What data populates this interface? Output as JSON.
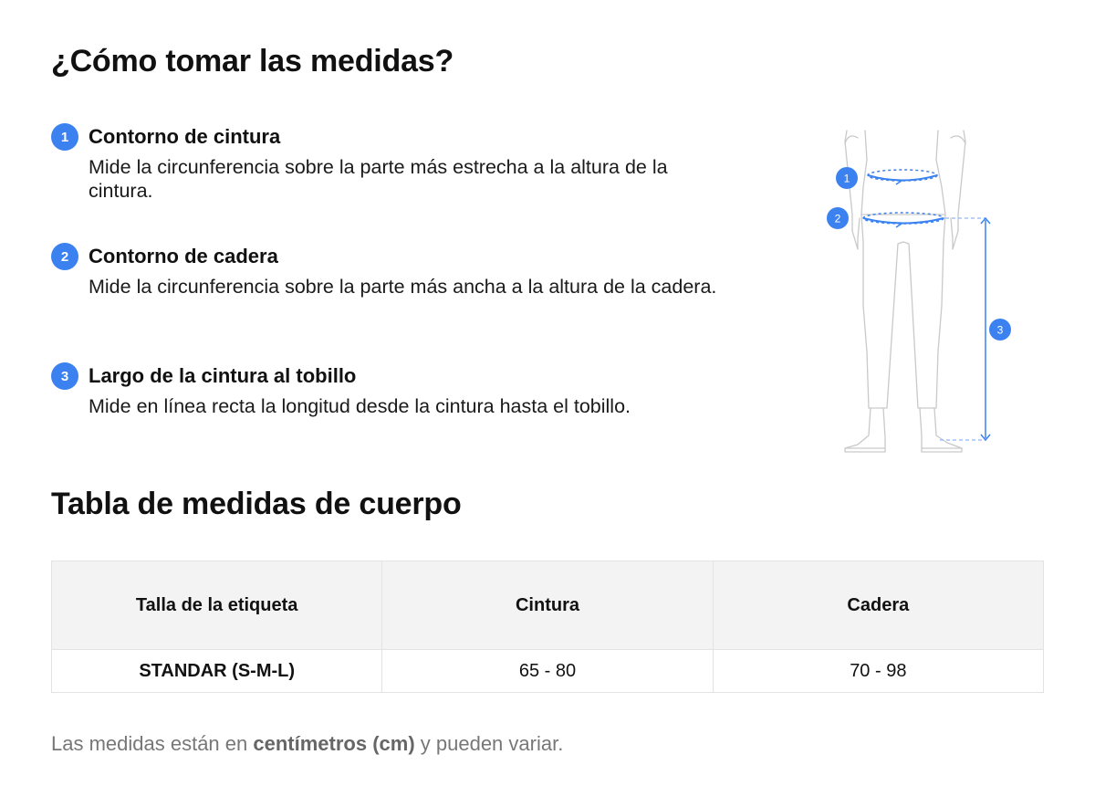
{
  "title": "¿Cómo tomar las medidas?",
  "steps": [
    {
      "number": "1",
      "title": "Contorno de cintura",
      "description": "Mide la circunferencia sobre la parte más estrecha a la altura de la cintura."
    },
    {
      "number": "2",
      "title": "Contorno de cadera",
      "description": "Mide la circunferencia sobre la parte más ancha a la altura de la cadera."
    },
    {
      "number": "3",
      "title": "Largo de la cintura al tobillo",
      "description": "Mide en línea recta la longitud desde la cintura hasta el tobillo."
    }
  ],
  "figure": {
    "icon": "body-measurement-diagram",
    "markers": [
      "1",
      "2",
      "3"
    ],
    "accent_color": "#3b82f0"
  },
  "table_title": "Tabla de medidas de cuerpo",
  "table": {
    "headers": [
      "Talla de la etiqueta",
      "Cintura",
      "Cadera"
    ],
    "rows": [
      [
        "STANDAR (S-M-L)",
        "65 - 80",
        "70 - 98"
      ]
    ]
  },
  "note": {
    "prefix": "Las medidas están en ",
    "bold": "centímetros (cm)",
    "suffix": " y pueden variar."
  },
  "colors": {
    "accent": "#3b82f0",
    "header_bg": "#f3f3f3",
    "note_text": "#777777"
  }
}
